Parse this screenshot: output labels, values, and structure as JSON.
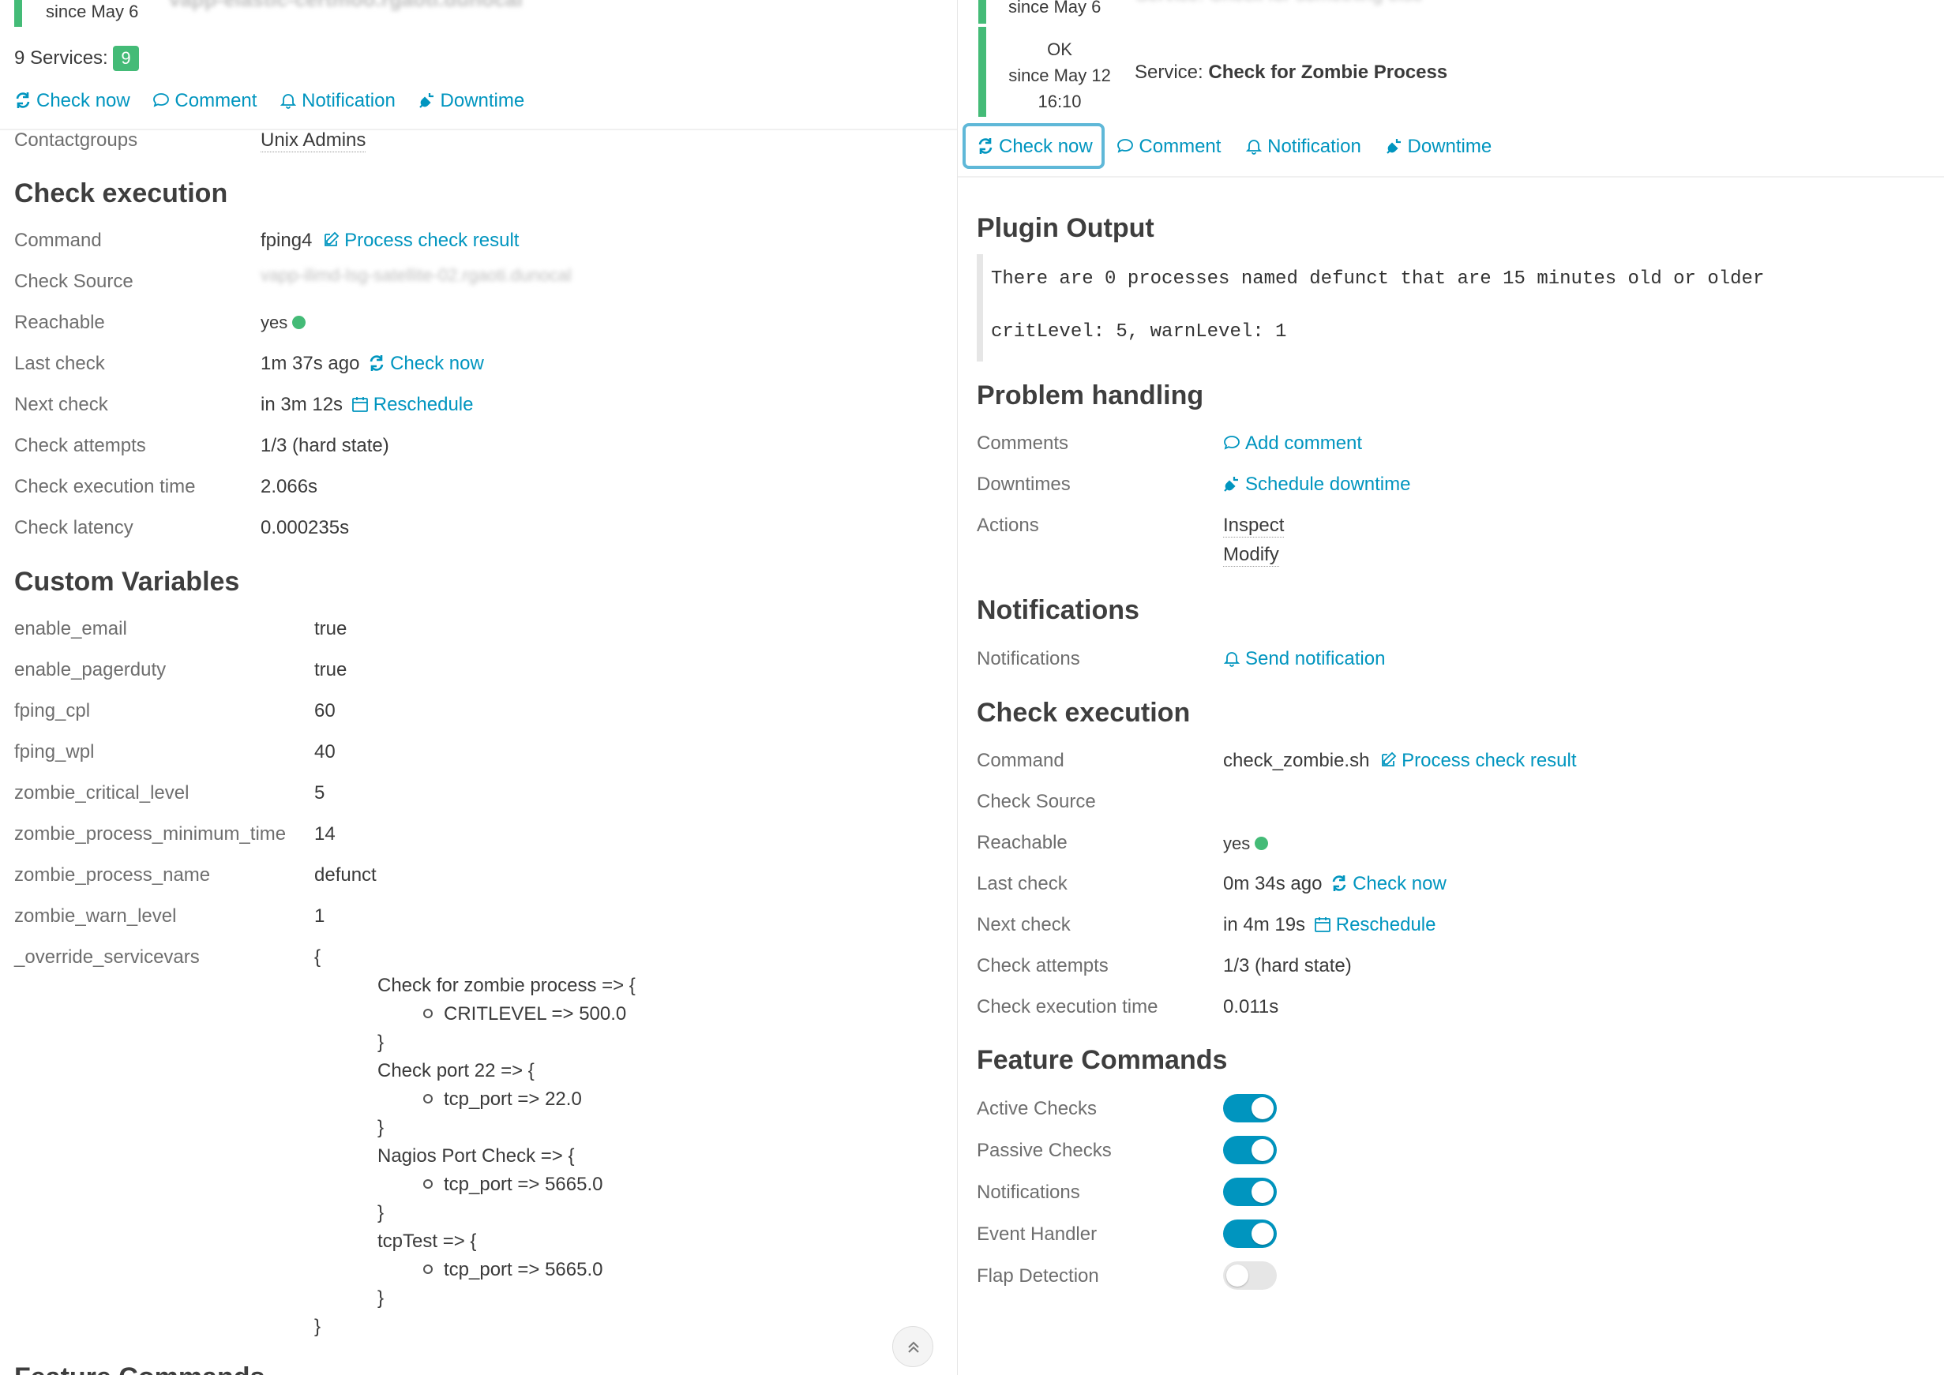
{
  "left": {
    "header": {
      "since": "since May 6",
      "hostname_blurred": "vapp-elastic-certmoo.rgaoti.dunocal",
      "services_label": "9 Services:",
      "services_count": "9",
      "actions": [
        "Check now",
        "Comment",
        "Notification",
        "Downtime"
      ]
    },
    "contactgroups": {
      "label": "Contactgroups",
      "value": "Unix Admins"
    },
    "check_execution": {
      "title": "Check execution",
      "rows": [
        {
          "label": "Command",
          "value": "fping4",
          "link": "Process check result"
        },
        {
          "label": "Check Source",
          "value": "vapp-ilimd-lsg-satellite-02.rgaoti.dunocal"
        },
        {
          "label": "Reachable",
          "value": "yes"
        },
        {
          "label": "Last check",
          "value": "1m 37s ago",
          "link": "Check now"
        },
        {
          "label": "Next check",
          "value": "in 3m 12s",
          "link": "Reschedule"
        },
        {
          "label": "Check attempts",
          "value": "1/3 (hard state)"
        },
        {
          "label": "Check execution time",
          "value": "2.066s"
        },
        {
          "label": "Check latency",
          "value": "0.000235s"
        }
      ]
    },
    "custom_variables": {
      "title": "Custom Variables",
      "rows": [
        {
          "label": "enable_email",
          "value": "true"
        },
        {
          "label": "enable_pagerduty",
          "value": "true"
        },
        {
          "label": "fping_cpl",
          "value": "60"
        },
        {
          "label": "fping_wpl",
          "value": "40"
        },
        {
          "label": "zombie_critical_level",
          "value": "5"
        },
        {
          "label": "zombie_process_minimum_time",
          "value": "14"
        },
        {
          "label": "zombie_process_name",
          "value": "defunct"
        },
        {
          "label": "zombie_warn_level",
          "value": "1"
        },
        {
          "label": "_override_servicevars",
          "value": "{"
        }
      ],
      "override": [
        {
          "key": "Check for zombie process => {",
          "item": "CRITLEVEL => 500.0"
        },
        {
          "key": "Check port 22 => {",
          "item": "tcp_port => 22.0"
        },
        {
          "key": "Nagios Port Check => {",
          "item": "tcp_port => 5665.0"
        },
        {
          "key": "tcpTest => {",
          "item": "tcp_port => 5665.0"
        }
      ],
      "close_inner": "}",
      "close_outer": "}"
    },
    "next_section_partial": "Feature Commands"
  },
  "right": {
    "header": {
      "since_top": "since May 6",
      "service_top_blurred": "Service: Check for something else",
      "state": "OK",
      "since": "since May 12",
      "time": "16:10",
      "service_prefix": "Service:",
      "service_name": "Check for Zombie Process",
      "actions": [
        "Check now",
        "Comment",
        "Notification",
        "Downtime"
      ]
    },
    "plugin_output": {
      "title": "Plugin Output",
      "line1": "There are 0 processes named defunct that are 15 minutes old or older",
      "line2": "critLevel: 5, warnLevel: 1"
    },
    "problem_handling": {
      "title": "Problem handling",
      "comments_label": "Comments",
      "comments_link": "Add comment",
      "downtimes_label": "Downtimes",
      "downtimes_link": "Schedule downtime",
      "actions_label": "Actions",
      "actions": [
        "Inspect",
        "Modify"
      ]
    },
    "notifications": {
      "title": "Notifications",
      "label": "Notifications",
      "link": "Send notification"
    },
    "check_execution": {
      "title": "Check execution",
      "rows": [
        {
          "label": "Command",
          "value": "check_zombie.sh",
          "link": "Process check result"
        },
        {
          "label": "Check Source",
          "value": ""
        },
        {
          "label": "Reachable",
          "value": "yes"
        },
        {
          "label": "Last check",
          "value": "0m 34s ago",
          "link": "Check now"
        },
        {
          "label": "Next check",
          "value": "in 4m 19s",
          "link": "Reschedule"
        },
        {
          "label": "Check attempts",
          "value": "1/3 (hard state)"
        },
        {
          "label": "Check execution time",
          "value": "0.011s"
        }
      ]
    },
    "feature_commands": {
      "title": "Feature Commands",
      "rows": [
        {
          "label": "Active Checks",
          "enabled": true
        },
        {
          "label": "Passive Checks",
          "enabled": true
        },
        {
          "label": "Notifications",
          "enabled": true
        },
        {
          "label": "Event Handler",
          "enabled": true
        },
        {
          "label": "Flap Detection",
          "enabled": false
        }
      ]
    }
  },
  "colors": {
    "link": "#0095bf",
    "ok": "#44bb77",
    "focus": "#5fb8d8"
  },
  "icons": [
    "refresh-icon",
    "comment-icon",
    "bell-icon",
    "plug-icon",
    "edit-icon",
    "calendar-icon",
    "chevron-up-icon"
  ]
}
